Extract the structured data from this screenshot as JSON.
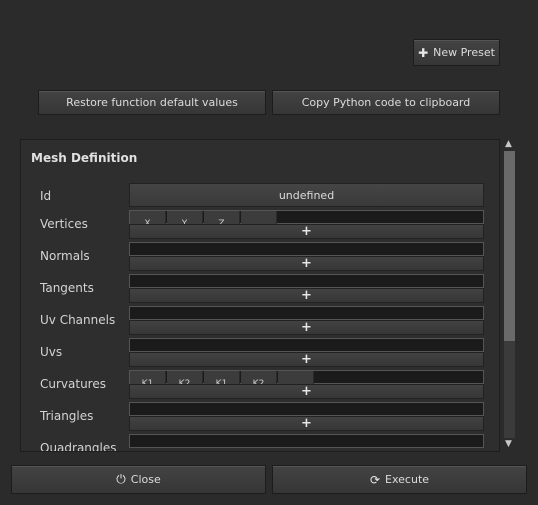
{
  "toolbar": {
    "new_preset_label": "New Preset",
    "restore_label": "Restore function default values",
    "copy_python_label": "Copy Python code to clipboard"
  },
  "section": {
    "title": "Mesh Definition",
    "id_label": "Id",
    "id_value": "undefined",
    "rows": [
      {
        "label": "Vertices",
        "headers": [
          "X",
          "Y",
          "Z",
          ""
        ]
      },
      {
        "label": "Normals"
      },
      {
        "label": "Tangents"
      },
      {
        "label": "Uv Channels"
      },
      {
        "label": "Uvs"
      },
      {
        "label": "Curvatures",
        "headers": [
          "K1",
          "K2",
          "K1",
          "K2",
          ""
        ]
      },
      {
        "label": "Triangles"
      },
      {
        "label": "Quadrangles"
      }
    ],
    "add_glyph": "+"
  },
  "footer": {
    "close_label": "Close",
    "execute_label": "Execute"
  },
  "icons": {
    "new_preset": "plus-icon",
    "close": "power-icon",
    "execute": "refresh-icon",
    "scroll_up": "arrow-up-icon",
    "scroll_down": "arrow-down-icon"
  }
}
